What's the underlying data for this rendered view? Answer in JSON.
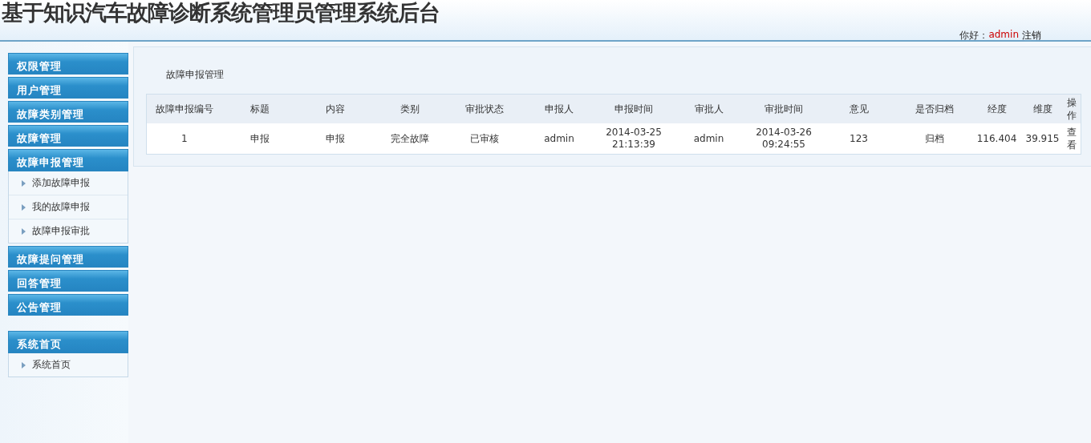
{
  "header": {
    "title": "基于知识汽车故障诊断系统管理员管理系统后台",
    "greeting": "你好：",
    "user": "admin",
    "logout": "注销"
  },
  "sidebar": {
    "menu": [
      {
        "label": "权限管理",
        "expanded": false
      },
      {
        "label": "用户管理",
        "expanded": false
      },
      {
        "label": "故障类别管理",
        "expanded": false
      },
      {
        "label": "故障管理",
        "expanded": false
      },
      {
        "label": "故障申报管理",
        "expanded": true,
        "children": [
          "添加故障申报",
          "我的故障申报",
          "故障申报审批"
        ]
      },
      {
        "label": "故障提问管理",
        "expanded": false
      },
      {
        "label": "回答管理",
        "expanded": false
      },
      {
        "label": "公告管理",
        "expanded": false
      }
    ],
    "home": [
      {
        "label": "系统首页",
        "expanded": true,
        "children": [
          "系统首页"
        ]
      }
    ]
  },
  "main": {
    "breadcrumb": "故障申报管理",
    "table": {
      "columns": [
        "故障申报编号",
        "标题",
        "内容",
        "类别",
        "审批状态",
        "申报人",
        "申报时间",
        "审批人",
        "审批时间",
        "意见",
        "是否归档",
        "经度",
        "维度",
        "操作"
      ],
      "rows": [
        {
          "cells": [
            "1",
            "申报",
            "申报",
            "完全故障",
            "已审核",
            "admin",
            "2014-03-25 21:13:39",
            "admin",
            "2014-03-26 09:24:55",
            "123",
            "归档",
            "116.404",
            "39.915"
          ],
          "action": "查看"
        }
      ]
    }
  }
}
